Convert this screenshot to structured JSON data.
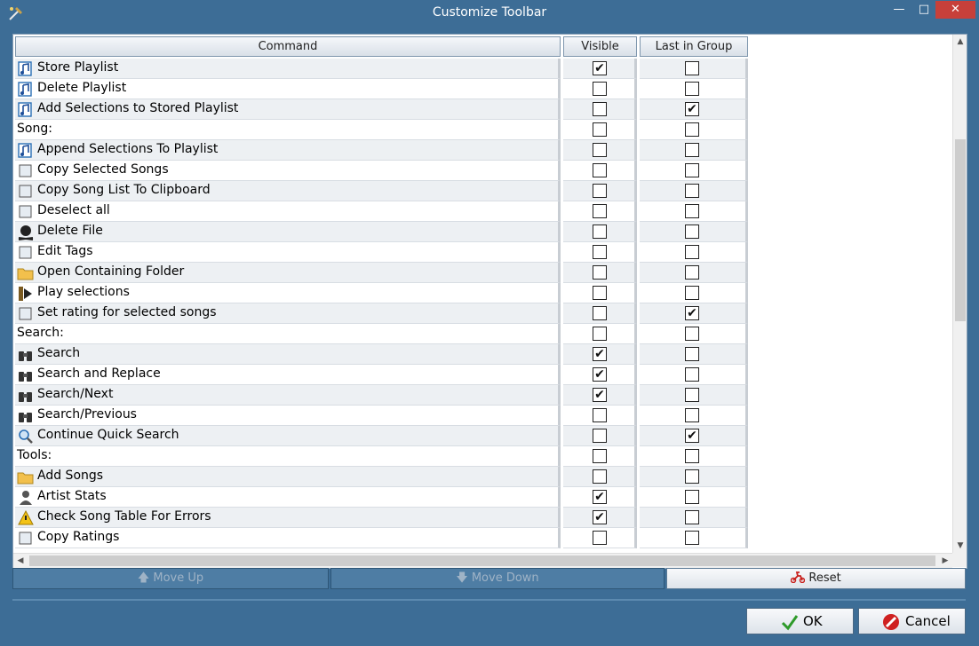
{
  "window": {
    "title": "Customize Toolbar",
    "min_icon": "minimize-icon",
    "max_icon": "maximize-icon",
    "close_icon": "close-icon"
  },
  "grid": {
    "columns": [
      "Command",
      "Visible",
      "Last in Group"
    ],
    "rows": [
      {
        "label": "Store Playlist",
        "icon": "playlist-save-icon",
        "group": false,
        "visible": true,
        "last": false
      },
      {
        "label": "Delete Playlist",
        "icon": "playlist-delete-icon",
        "group": false,
        "visible": false,
        "last": false
      },
      {
        "label": "Add Selections to Stored Playlist",
        "icon": "playlist-add-icon",
        "group": false,
        "visible": false,
        "last": true
      },
      {
        "label": "Song:",
        "icon": "",
        "group": true,
        "visible": false,
        "last": false
      },
      {
        "label": "Append Selections To Playlist",
        "icon": "playlist-append-icon",
        "group": false,
        "visible": false,
        "last": false
      },
      {
        "label": "Copy Selected Songs",
        "icon": "copy-songs-icon",
        "group": false,
        "visible": false,
        "last": false
      },
      {
        "label": "Copy Song List To Clipboard",
        "icon": "clipboard-icon",
        "group": false,
        "visible": false,
        "last": false
      },
      {
        "label": "Deselect all",
        "icon": "deselect-icon",
        "group": false,
        "visible": false,
        "last": false
      },
      {
        "label": "Delete File",
        "icon": "skull-icon",
        "group": false,
        "visible": false,
        "last": false
      },
      {
        "label": "Edit Tags",
        "icon": "tag-edit-icon",
        "group": false,
        "visible": false,
        "last": false
      },
      {
        "label": "Open Containing Folder",
        "icon": "folder-icon",
        "group": false,
        "visible": false,
        "last": false
      },
      {
        "label": "Play selections",
        "icon": "play-icon",
        "group": false,
        "visible": false,
        "last": false
      },
      {
        "label": "Set rating for selected songs",
        "icon": "rating-icon",
        "group": false,
        "visible": false,
        "last": true
      },
      {
        "label": "Search:",
        "icon": "",
        "group": true,
        "visible": false,
        "last": false
      },
      {
        "label": "Search",
        "icon": "binoculars-icon",
        "group": false,
        "visible": true,
        "last": false
      },
      {
        "label": "Search and Replace",
        "icon": "binoculars-replace-icon",
        "group": false,
        "visible": true,
        "last": false
      },
      {
        "label": "Search/Next",
        "icon": "binoculars-next-icon",
        "group": false,
        "visible": true,
        "last": false
      },
      {
        "label": "Search/Previous",
        "icon": "binoculars-prev-icon",
        "group": false,
        "visible": false,
        "last": false
      },
      {
        "label": "Continue Quick Search",
        "icon": "magnifier-icon",
        "group": false,
        "visible": false,
        "last": true
      },
      {
        "label": "Tools:",
        "icon": "",
        "group": true,
        "visible": false,
        "last": false
      },
      {
        "label": "Add Songs",
        "icon": "folder-add-icon",
        "group": false,
        "visible": false,
        "last": false
      },
      {
        "label": "Artist Stats",
        "icon": "artist-icon",
        "group": false,
        "visible": true,
        "last": false
      },
      {
        "label": "Check Song Table For Errors",
        "icon": "warning-icon",
        "group": false,
        "visible": true,
        "last": false
      },
      {
        "label": "Copy Ratings",
        "icon": "copy-ratings-icon",
        "group": false,
        "visible": false,
        "last": false
      }
    ]
  },
  "actions": {
    "move_up": "Move Up",
    "move_down": "Move Down",
    "reset": "Reset",
    "move_up_icon": "arrow-up-icon",
    "move_down_icon": "arrow-down-icon",
    "reset_icon": "scooter-icon"
  },
  "dialog": {
    "ok": "OK",
    "cancel": "Cancel",
    "ok_icon": "checkmark-icon",
    "cancel_icon": "cancel-icon"
  },
  "colors": {
    "frame": "#3d6d96",
    "close": "#c7403a",
    "check": "#111111"
  }
}
